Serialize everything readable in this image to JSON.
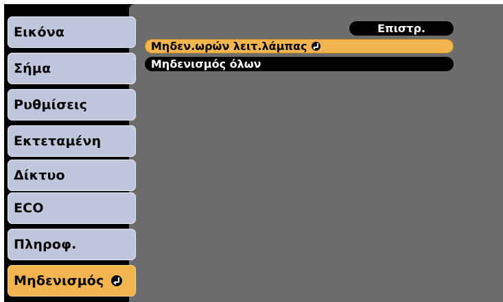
{
  "sidebar": {
    "items": [
      {
        "label": "Εικόνα"
      },
      {
        "label": "Σήμα"
      },
      {
        "label": "Ρυθμίσεις"
      },
      {
        "label": "Εκτεταμένη"
      },
      {
        "label": "Δίκτυο"
      },
      {
        "label": "ECO"
      },
      {
        "label": "Πληροφ."
      },
      {
        "label": "Μηδενισμός",
        "selected": true,
        "icon": "enter-icon"
      }
    ]
  },
  "panel": {
    "back_label": "Επιστρ.",
    "options": [
      {
        "label": "Μηδεν.ωρών λειτ.λάμπας",
        "selected": true,
        "icon": "enter-icon"
      },
      {
        "label": "Μηδενισμός όλων",
        "selected": false
      }
    ]
  },
  "colors": {
    "highlight": "#f2b44e",
    "menu_item": "#c0c6dc",
    "panel": "#6d6d6d",
    "background": "#000000"
  }
}
